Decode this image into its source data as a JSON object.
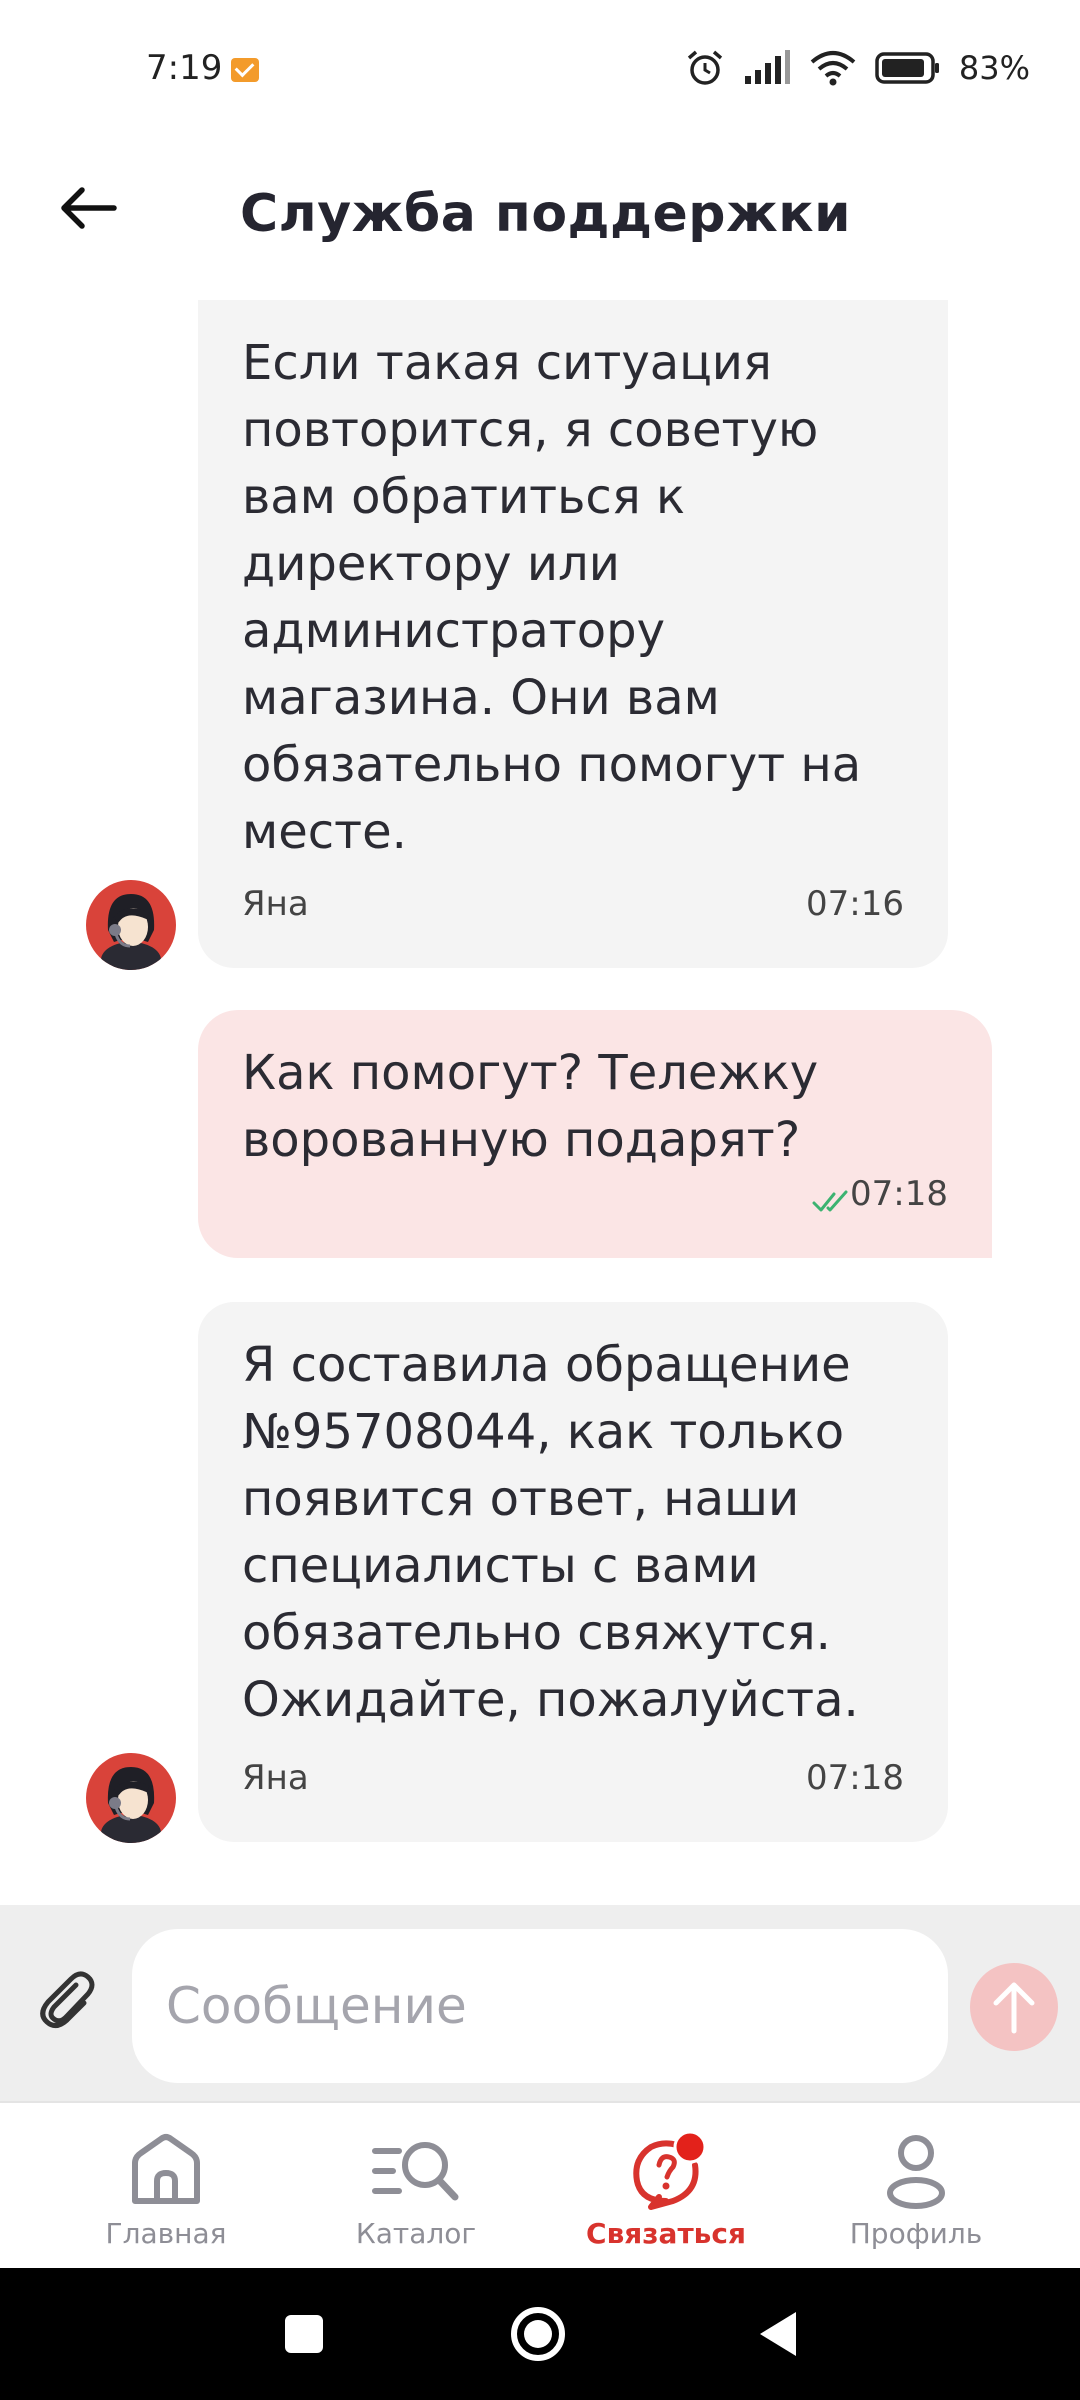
{
  "status_bar": {
    "time": "7:19",
    "battery_percent": "83%",
    "icons": [
      "mail-notification-icon",
      "alarm-icon",
      "signal-icon",
      "wifi-icon",
      "battery-icon"
    ]
  },
  "header": {
    "title": "Служба поддержки",
    "back_icon": "arrow-left-icon"
  },
  "messages": [
    {
      "direction": "incoming",
      "text": "Если такая ситуация\nповторится, я советую\nвам обратиться к\nдиректору или\nадминистратору\nмагазина. Они вам\nобязательно помогут на\nместе.",
      "author": "Яна",
      "time": "07:16"
    },
    {
      "direction": "outgoing",
      "text": "Как помогут? Тележку\nворованную подарят?",
      "time": "07:18",
      "read": true
    },
    {
      "direction": "incoming",
      "text": "Я составила обращение\n№95708044, как только\nпоявится ответ, наши\nспециалисты с вами\nобязательно свяжутся.\nОжидайте, пожалуйста.",
      "author": "Яна",
      "time": "07:18"
    }
  ],
  "composer": {
    "placeholder": "Сообщение",
    "value": ""
  },
  "bottom_nav": {
    "items": [
      {
        "label": "Главная",
        "icon": "home-icon",
        "active": false
      },
      {
        "label": "Каталог",
        "icon": "catalog-search-icon",
        "active": false
      },
      {
        "label": "Связаться",
        "icon": "chat-support-icon",
        "active": true
      },
      {
        "label": "Профиль",
        "icon": "profile-icon",
        "active": false
      }
    ]
  },
  "colors": {
    "accent": "#d8332d",
    "incoming_bubble": "#f4f4f4",
    "outgoing_bubble": "#fbe5e5",
    "read_check": "#3cb371",
    "send_button": "#f4c3c3"
  }
}
